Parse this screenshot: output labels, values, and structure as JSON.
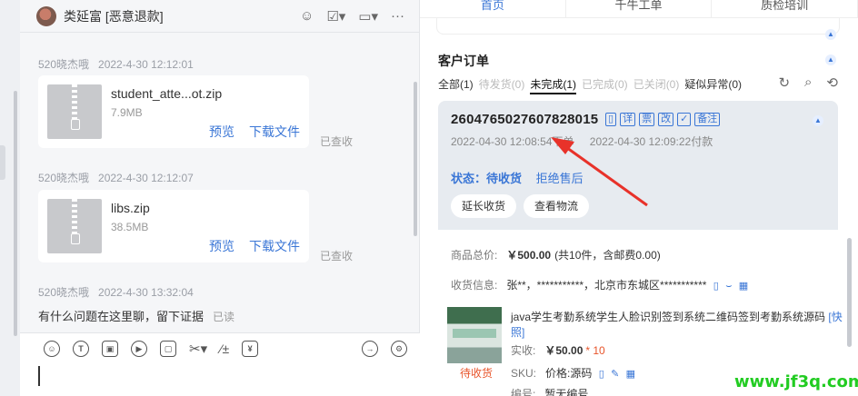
{
  "chat": {
    "title": "类延富 [恶意退款]",
    "messages": [
      {
        "sender": "520晓杰哦",
        "time": "2022-4-30 12:12:01",
        "file_name": "student_atte...ot.zip",
        "file_size": "7.9MB",
        "preview": "预览",
        "download": "下载文件",
        "read": "已查收"
      },
      {
        "sender": "520晓杰哦",
        "time": "2022-4-30 12:12:07",
        "file_name": "libs.zip",
        "file_size": "38.5MB",
        "preview": "预览",
        "download": "下载文件",
        "read": "已查收"
      },
      {
        "sender": "520晓杰哦",
        "time": "2022-4-30 13:32:04",
        "text": "有什么问题在这里聊，留下证据",
        "read": "已读"
      }
    ]
  },
  "tabs": [
    "首页",
    "千牛工单",
    "质检培训"
  ],
  "orders": {
    "section_title": "客户订单",
    "filters": [
      {
        "label": "全部(1)",
        "state": "on"
      },
      {
        "label": "待发货(0)",
        "state": "off"
      },
      {
        "label": "未完成(1)",
        "state": "current"
      },
      {
        "label": "已完成(0)",
        "state": "off"
      },
      {
        "label": "已关闭(0)",
        "state": "off"
      },
      {
        "label": "疑似异常(0)",
        "state": "on"
      }
    ],
    "order_no": "2604765027607828015",
    "tags": [
      "详",
      "票",
      "改",
      "备注"
    ],
    "order_time": "2022-04-30 12:08:54下单",
    "pay_time": "2022-04-30 12:09:22付款",
    "status_label": "状态：",
    "status_value": "待收货",
    "refuse": "拒绝售后",
    "btn_extend": "延长收货",
    "btn_logistics": "查看物流",
    "total_label": "商品总价:",
    "total_value": "￥500.00",
    "total_note": "(共10件，含邮费0.00)",
    "address_label": "收货信息:",
    "address_value": "张**，***********，北京市东城区***********",
    "product_title": "java学生考勤系统学生人脸识别签到系统二维码签到考勤系统源码",
    "product_quick": "[快照]",
    "product_status": "待收货",
    "paid_label": "实收:",
    "paid_value": "￥50.00",
    "paid_qty": "* 10",
    "sku_label": "SKU:",
    "sku_value": "价格:源码",
    "code_label": "编号:",
    "code_value": "暂无编号"
  },
  "watermark": "www.jf3q.com",
  "colors": {
    "accent": "#3a76d6",
    "price": "#e8542a",
    "annotation": "#e8322a",
    "watermark": "#22cc22"
  }
}
